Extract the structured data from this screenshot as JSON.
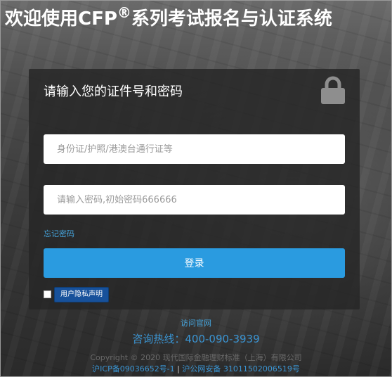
{
  "header": {
    "title_before": "欢迎使用CFP",
    "title_reg": "®",
    "title_after": "系列考试报名与认证系统"
  },
  "login_card": {
    "title": "请输入您的证件号和密码",
    "lock_icon": "lock-icon",
    "id_placeholder": "身份证/护照/港澳台通行证等",
    "password_placeholder": "请输入密码,初始密码666666",
    "forgot_password": "忘记密码",
    "login_button": "登录",
    "privacy_button": "用户隐私声明"
  },
  "footer": {
    "visit_site": "访问官网",
    "hotline": "咨询热线：400-090-3939",
    "copyright": "Copyright © 2020 现代国际金融理财标准（上海）有限公司",
    "icp": "沪ICP备09036652号-1",
    "separator": "|",
    "police": "沪公网安备 31011502006519号"
  },
  "colors": {
    "accent_blue": "#2a9be0",
    "link_blue": "#46a7e0",
    "privacy_button_bg": "#17519b",
    "card_bg": "#262626"
  }
}
